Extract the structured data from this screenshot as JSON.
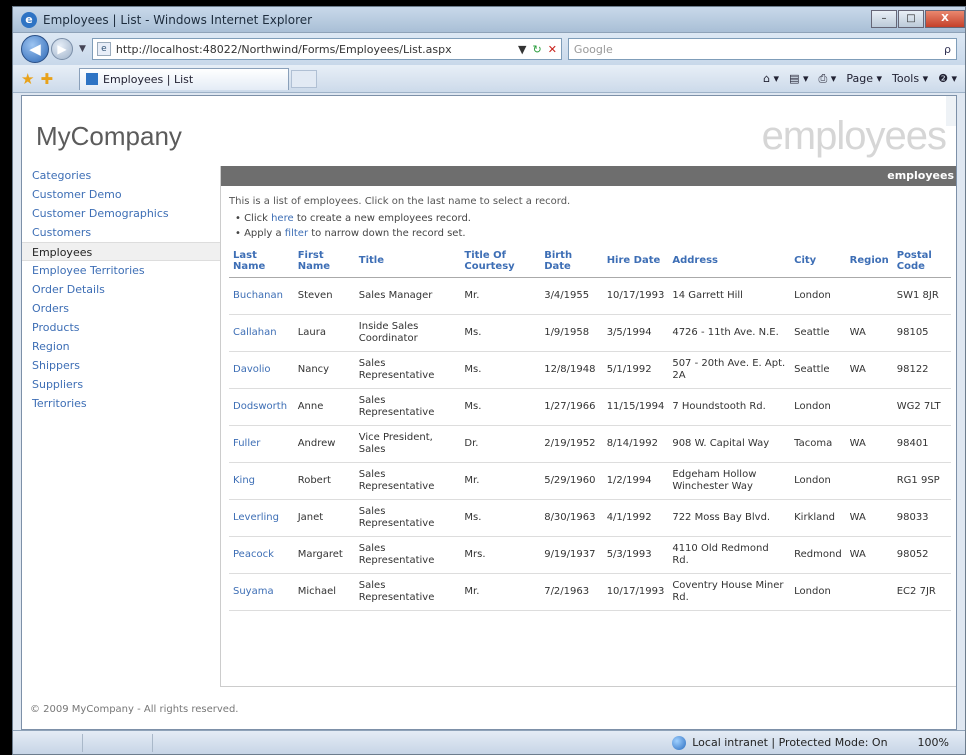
{
  "window": {
    "title": "Employees | List - Windows Internet Explorer",
    "min": "–",
    "max": "□",
    "close": "X"
  },
  "nav": {
    "back": "◀",
    "forward": "▶",
    "address": "http://localhost:48022/Northwind/Forms/Employees/List.aspx",
    "search_placeholder": "Google",
    "search_icon": "ρ"
  },
  "cmd": {
    "tab_title": "Employees | List",
    "page": "Page ▾",
    "tools": "Tools ▾",
    "help": "❷ ▾"
  },
  "site": {
    "logo": "MyCompany",
    "banner": "employees",
    "bar_title": "employees"
  },
  "sidebar": {
    "items": [
      {
        "label": "Categories"
      },
      {
        "label": "Customer Demo"
      },
      {
        "label": "Customer Demographics"
      },
      {
        "label": "Customers"
      },
      {
        "label": "Employees"
      },
      {
        "label": "Employee Territories"
      },
      {
        "label": "Order Details"
      },
      {
        "label": "Orders"
      },
      {
        "label": "Products"
      },
      {
        "label": "Region"
      },
      {
        "label": "Shippers"
      },
      {
        "label": "Suppliers"
      },
      {
        "label": "Territories"
      }
    ],
    "selected_index": 4
  },
  "main": {
    "intro": "This is a list of employees. Click on the last name to select a record.",
    "bullet1_pre": "• Click ",
    "bullet1_link": "here",
    "bullet1_post": " to create a new employees record.",
    "bullet2_pre": "• Apply a ",
    "bullet2_link": "filter",
    "bullet2_post": " to narrow down the record set."
  },
  "table": {
    "headers": [
      "Last Name",
      "First Name",
      "Title",
      "Title Of Courtesy",
      "Birth Date",
      "Hire Date",
      "Address",
      "City",
      "Region",
      "Postal Code"
    ],
    "rows": [
      [
        "Buchanan",
        "Steven",
        "Sales Manager",
        "Mr.",
        "3/4/1955",
        "10/17/1993",
        "14 Garrett Hill",
        "London",
        "",
        "SW1 8JR"
      ],
      [
        "Callahan",
        "Laura",
        "Inside Sales Coordinator",
        "Ms.",
        "1/9/1958",
        "3/5/1994",
        "4726 - 11th Ave. N.E.",
        "Seattle",
        "WA",
        "98105"
      ],
      [
        "Davolio",
        "Nancy",
        "Sales Representative",
        "Ms.",
        "12/8/1948",
        "5/1/1992",
        "507 - 20th Ave. E. Apt. 2A",
        "Seattle",
        "WA",
        "98122"
      ],
      [
        "Dodsworth",
        "Anne",
        "Sales Representative",
        "Ms.",
        "1/27/1966",
        "11/15/1994",
        "7 Houndstooth Rd.",
        "London",
        "",
        "WG2 7LT"
      ],
      [
        "Fuller",
        "Andrew",
        "Vice President, Sales",
        "Dr.",
        "2/19/1952",
        "8/14/1992",
        "908 W. Capital Way",
        "Tacoma",
        "WA",
        "98401"
      ],
      [
        "King",
        "Robert",
        "Sales Representative",
        "Mr.",
        "5/29/1960",
        "1/2/1994",
        "Edgeham Hollow Winchester Way",
        "London",
        "",
        "RG1 9SP"
      ],
      [
        "Leverling",
        "Janet",
        "Sales Representative",
        "Ms.",
        "8/30/1963",
        "4/1/1992",
        "722 Moss Bay Blvd.",
        "Kirkland",
        "WA",
        "98033"
      ],
      [
        "Peacock",
        "Margaret",
        "Sales Representative",
        "Mrs.",
        "9/19/1937",
        "5/3/1993",
        "4110 Old Redmond Rd.",
        "Redmond",
        "WA",
        "98052"
      ],
      [
        "Suyama",
        "Michael",
        "Sales Representative",
        "Mr.",
        "7/2/1963",
        "10/17/1993",
        "Coventry House Miner Rd.",
        "London",
        "",
        "EC2 7JR"
      ]
    ]
  },
  "footer": "© 2009 MyCompany - All rights reserved.",
  "status": {
    "zone": "Local intranet | Protected Mode: On",
    "zoom": "100%"
  }
}
